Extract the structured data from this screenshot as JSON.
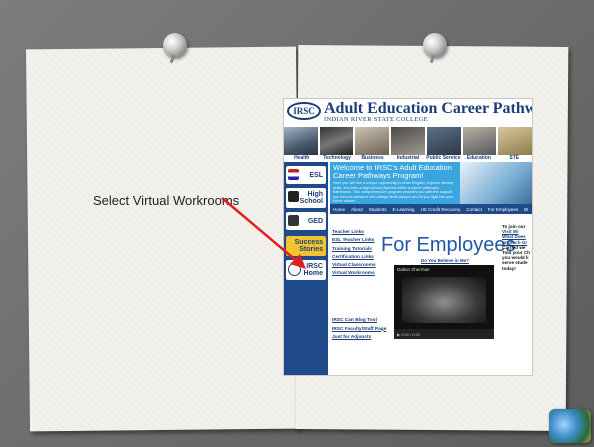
{
  "instruction": "Select Virtual Workrooms",
  "site": {
    "logo": "IRSC",
    "title": "Adult Education Career Pathways",
    "subtitle": "INDIAN RIVER STATE COLLEGE",
    "categories": [
      "Health",
      "Technology",
      "Business",
      "Industrial",
      "Public Service",
      "Education",
      "STE"
    ],
    "sidebar": [
      "ESL",
      "High School",
      "GED",
      "Success Stories",
      "IRSC Home"
    ],
    "welcome_title": "Welcome to IRSC's Adult Education Career Pathways Program!",
    "welcome_text": "Here you will find a unique opportunity to learn English, improve literacy skills, and earn a high school diploma within a career pathways framework. This comprehensive program provides you with the support you need to advance into college level classes and fit you right into your future career!",
    "nav": [
      "Home",
      "About",
      "Students",
      "E-Learning",
      "HS Credit Recovery",
      "Contact",
      "For Employees",
      "BI"
    ],
    "links": [
      "Teacher Links",
      "ESL Teacher Links",
      "Training Tutorials",
      "Certification Links",
      "Virtual Classrooms",
      "Virtual Workrooms"
    ],
    "links2": [
      "IRSC Can Blog Tool",
      "IRSC Faculty/Staff Page",
      "Just for Adjuncts"
    ],
    "heading": "For Employees",
    "video_caption": "Do You Believe in Me?",
    "video_title": "Dalton Sherman",
    "video_time": "0:00 / 0:00",
    "right_col": [
      "To join our",
      "Visit Wi",
      "What Does",
      "to Teach Gr",
      "Carried we",
      "Told your Ch",
      "you would li",
      "serve stude",
      "today!"
    ]
  }
}
